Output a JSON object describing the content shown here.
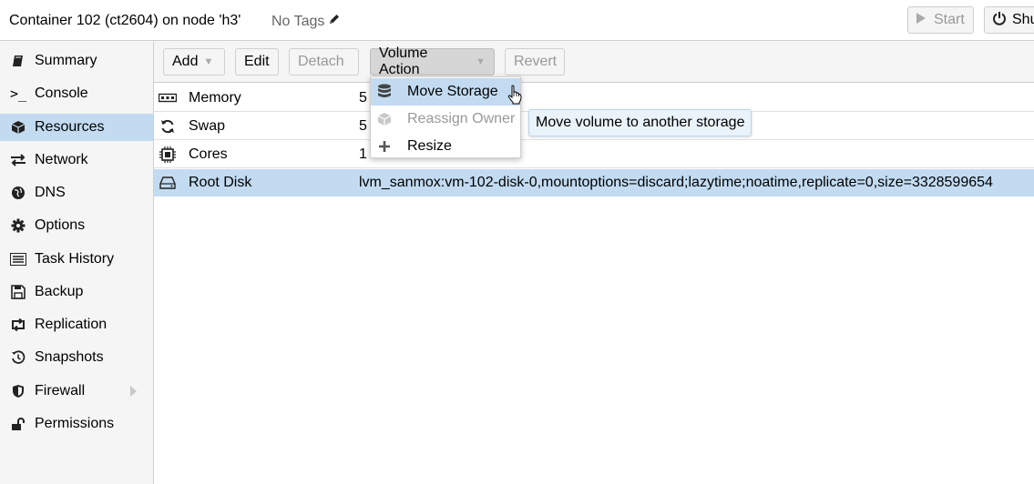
{
  "header": {
    "title": "Container 102 (ct2604) on node 'h3'",
    "tags_label": "No Tags",
    "start_label": "Start",
    "shutdown_label": "Shu"
  },
  "sidebar": {
    "items": [
      {
        "label": "Summary",
        "icon": "book-icon"
      },
      {
        "label": "Console",
        "icon": "terminal-icon"
      },
      {
        "label": "Resources",
        "icon": "cube-icon",
        "active": true
      },
      {
        "label": "Network",
        "icon": "exchange-icon"
      },
      {
        "label": "DNS",
        "icon": "globe-icon"
      },
      {
        "label": "Options",
        "icon": "gear-icon"
      },
      {
        "label": "Task History",
        "icon": "list-icon"
      },
      {
        "label": "Backup",
        "icon": "floppy-icon"
      },
      {
        "label": "Replication",
        "icon": "retweet-icon"
      },
      {
        "label": "Snapshots",
        "icon": "history-icon"
      },
      {
        "label": "Firewall",
        "icon": "shield-icon"
      },
      {
        "label": "Permissions",
        "icon": "unlock-icon"
      }
    ]
  },
  "toolbar": {
    "add_label": "Add",
    "edit_label": "Edit",
    "detach_label": "Detach",
    "volume_action_label": "Volume Action",
    "revert_label": "Revert"
  },
  "resources": {
    "rows": [
      {
        "key": "Memory",
        "value": "5",
        "icon": "memory-icon"
      },
      {
        "key": "Swap",
        "value": "5",
        "icon": "refresh-icon"
      },
      {
        "key": "Cores",
        "value": "1",
        "icon": "cpu-icon"
      },
      {
        "key": "Root Disk",
        "value": "lvm_sanmox:vm-102-disk-0,mountoptions=discard;lazytime;noatime,replicate=0,size=3328599654",
        "icon": "hdd-icon"
      }
    ]
  },
  "volume_menu": {
    "items": [
      {
        "label": "Move Storage",
        "icon": "database-icon"
      },
      {
        "label": "Reassign Owner",
        "icon": "cube-icon",
        "disabled": true
      },
      {
        "label": "Resize",
        "icon": "plus-icon"
      }
    ]
  },
  "tooltip": {
    "text": "Move volume to another storage"
  },
  "colors": {
    "selection": "#c2dbf1",
    "background": "#f5f5f5",
    "border": "#cfcfcf"
  }
}
